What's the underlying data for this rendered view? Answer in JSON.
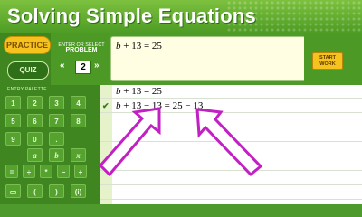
{
  "header": {
    "title": "Solving Simple Equations"
  },
  "modes": {
    "practice_label": "PRACTICE",
    "quiz_label": "QUIZ"
  },
  "selector": {
    "label_line1": "ENTER OR SELECT",
    "label_line2": "PROBLEM",
    "prev_arrow": "«",
    "next_arrow": "»",
    "value": "2"
  },
  "entry": {
    "equation": "b + 13 = 25"
  },
  "start_work": {
    "label_line1": "START",
    "label_line2": "WORK"
  },
  "palette": {
    "label": "ENTRY PALETTE",
    "keys_row1": [
      "1",
      "2",
      "3",
      "4"
    ],
    "keys_row2": [
      "5",
      "6",
      "7",
      "8"
    ],
    "keys_row3": [
      "9",
      "0",
      "."
    ],
    "keys_row4": [
      "a",
      "b",
      "x",
      "y"
    ],
    "keys_row5": [
      "=",
      "÷",
      "*",
      "−",
      "+"
    ],
    "keys_row6": [
      "▭",
      "(",
      ")",
      "(i)"
    ]
  },
  "work": {
    "lines": [
      "b + 13 = 25",
      "b + 13 − 13 = 25 − 13"
    ],
    "check_icon": "checkmark-icon"
  },
  "colors": {
    "header_green": "#6fb534",
    "accent_yellow": "#f6c21d",
    "annotation_magenta": "#c21fc4"
  }
}
